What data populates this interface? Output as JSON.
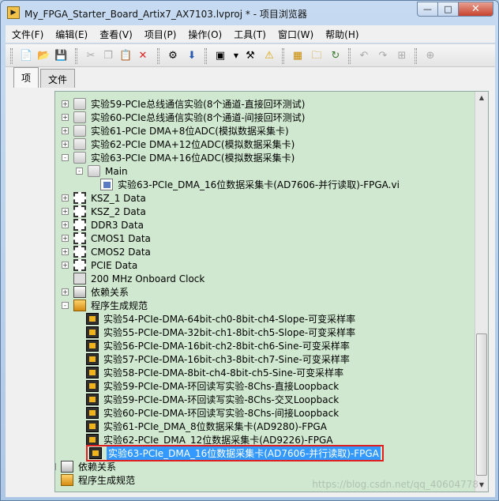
{
  "window": {
    "title": "My_FPGA_Starter_Board_Artix7_AX7103.lvproj * - 项目浏览器",
    "min_glyph": "—",
    "max_glyph": "□",
    "close_glyph": "✕"
  },
  "menu": [
    "文件(F)",
    "编辑(E)",
    "查看(V)",
    "项目(P)",
    "操作(O)",
    "工具(T)",
    "窗口(W)",
    "帮助(H)"
  ],
  "toolbar_icons": {
    "new": "📄",
    "open": "📂",
    "save": "💾",
    "cut": "✂",
    "copy": "❐",
    "paste": "📋",
    "delete": "✕",
    "properties": "⚙",
    "deploy": "⬇",
    "view_menu": "▣",
    "build": "⚒",
    "warning": "⚠",
    "organize": "▦",
    "folder": "🗀",
    "refresh": "↻",
    "undo": "↶",
    "redo": "↷",
    "expand": "⊞"
  },
  "tabs": [
    "项",
    "文件"
  ],
  "tree": [
    {
      "label": "实验59-PCIe总线通信实验(8个通道-直接回环测试)",
      "icon": "folder",
      "exp": "+"
    },
    {
      "label": "实验60-PCIe总线通信实验(8个通道-间接回环测试)",
      "icon": "folder",
      "exp": "+"
    },
    {
      "label": "实验61-PCIe DMA+8位ADC(模拟数据采集卡)",
      "icon": "folder",
      "exp": "+"
    },
    {
      "label": "实验62-PCIe DMA+12位ADC(模拟数据采集卡)",
      "icon": "folder",
      "exp": "+"
    },
    {
      "label": "实验63-PCIe DMA+16位ADC(模拟数据采集卡)",
      "icon": "folder",
      "exp": "-"
    },
    {
      "label": "Main",
      "icon": "folder",
      "exp": "-"
    },
    {
      "label": "实验63-PCIe_DMA_16位数据采集卡(AD7606-并行读取)-FPGA.vi",
      "icon": "vi",
      "exp": ""
    },
    {
      "label": "KSZ_1 Data",
      "icon": "chip",
      "exp": "+"
    },
    {
      "label": "KSZ_2 Data",
      "icon": "chip",
      "exp": "+"
    },
    {
      "label": "DDR3 Data",
      "icon": "chip",
      "exp": "+"
    },
    {
      "label": "CMOS1 Data",
      "icon": "chip",
      "exp": "+"
    },
    {
      "label": "CMOS2 Data",
      "icon": "chip",
      "exp": "+"
    },
    {
      "label": "PCIE Data",
      "icon": "chip",
      "exp": "+"
    },
    {
      "label": "200 MHz Onboard Clock",
      "icon": "clock",
      "exp": ""
    },
    {
      "label": "依赖关系",
      "icon": "deps",
      "exp": "+"
    },
    {
      "label": "程序生成规范",
      "icon": "build",
      "exp": "-"
    },
    {
      "label": "实验54-PCIe-DMA-64bit-ch0-8bit-ch4-Slope-可变采样率",
      "icon": "bitfile",
      "exp": ""
    },
    {
      "label": "实验55-PCIe-DMA-32bit-ch1-8bit-ch5-Slope-可变采样率",
      "icon": "bitfile",
      "exp": ""
    },
    {
      "label": "实验56-PCIe-DMA-16bit-ch2-8bit-ch6-Sine-可变采样率",
      "icon": "bitfile",
      "exp": ""
    },
    {
      "label": "实验57-PCIe-DMA-16bit-ch3-8bit-ch7-Sine-可变采样率",
      "icon": "bitfile",
      "exp": ""
    },
    {
      "label": "实验58-PCIe-DMA-8bit-ch4-8bit-ch5-Sine-可变采样率",
      "icon": "bitfile",
      "exp": ""
    },
    {
      "label": "实验59-PCIe-DMA-环回读写实验-8Chs-直接Loopback",
      "icon": "bitfile",
      "exp": ""
    },
    {
      "label": "实验59-PCIe-DMA-环回读写实验-8Chs-交叉Loopback",
      "icon": "bitfile",
      "exp": ""
    },
    {
      "label": "实验60-PCIe-DMA-环回读写实验-8Chs-间接Loopback",
      "icon": "bitfile",
      "exp": ""
    },
    {
      "label": "实验61-PCIe_DMA_8位数据采集卡(AD9280)-FPGA",
      "icon": "bitfile",
      "exp": ""
    },
    {
      "label": "实验62-PCIe_DMA_12位数据采集卡(AD9226)-FPGA",
      "icon": "bitfile",
      "exp": ""
    },
    {
      "label": "实验63-PCIe_DMA_16位数据采集卡(AD7606-并行读取)-FPGA",
      "icon": "bitfile",
      "exp": "",
      "selected": true
    },
    {
      "label": "依赖关系",
      "icon": "deps",
      "exp": "+"
    },
    {
      "label": "程序生成规范",
      "icon": "build",
      "exp": ""
    }
  ],
  "scrollbar": {
    "up": "▲",
    "down": "▼"
  },
  "watermark": "https://blog.csdn.net/qq_40604778"
}
